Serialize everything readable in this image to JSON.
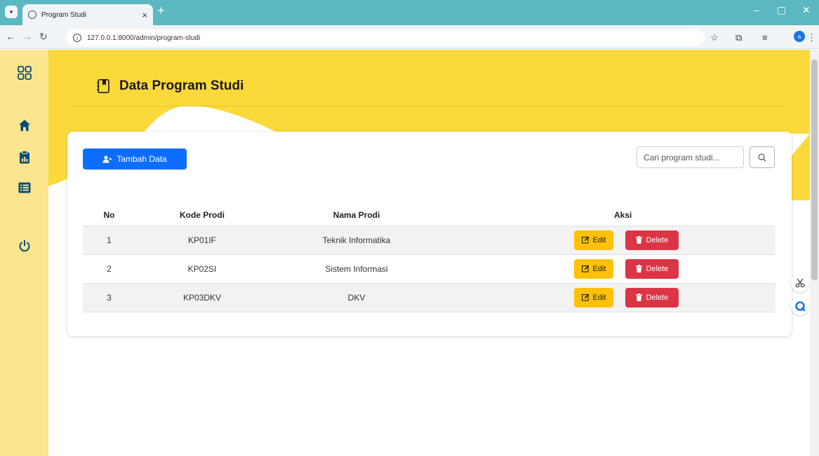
{
  "browser": {
    "tab_title": "Program Studi",
    "url": "127.0.0.1:8000/admin/program-studi"
  },
  "sidebar": {
    "items": [
      {
        "icon": "grid-icon"
      },
      {
        "icon": "home-icon"
      },
      {
        "icon": "clipboard-chart-icon"
      },
      {
        "icon": "list-icon"
      },
      {
        "icon": "power-icon"
      }
    ]
  },
  "header": {
    "title": "Data Program Studi"
  },
  "toolbar": {
    "add_label": "Tambah Data",
    "search_placeholder": "Cari program studi..."
  },
  "table": {
    "columns": [
      "No",
      "Kode Prodi",
      "Nama Prodi",
      "Aksi"
    ],
    "rows": [
      {
        "no": "1",
        "kode": "KP01IF",
        "nama": "Teknik Informatika"
      },
      {
        "no": "2",
        "kode": "KP02SI",
        "nama": "Sistem Informasi"
      },
      {
        "no": "3",
        "kode": "KP03DKV",
        "nama": "DKV"
      }
    ],
    "edit_label": "Edit",
    "delete_label": "Delete"
  },
  "colors": {
    "sidebar": "#fbe58d",
    "banner": "#fcd93a",
    "primary": "#0d6efd",
    "edit": "#ffc107",
    "delete": "#dc3545"
  }
}
